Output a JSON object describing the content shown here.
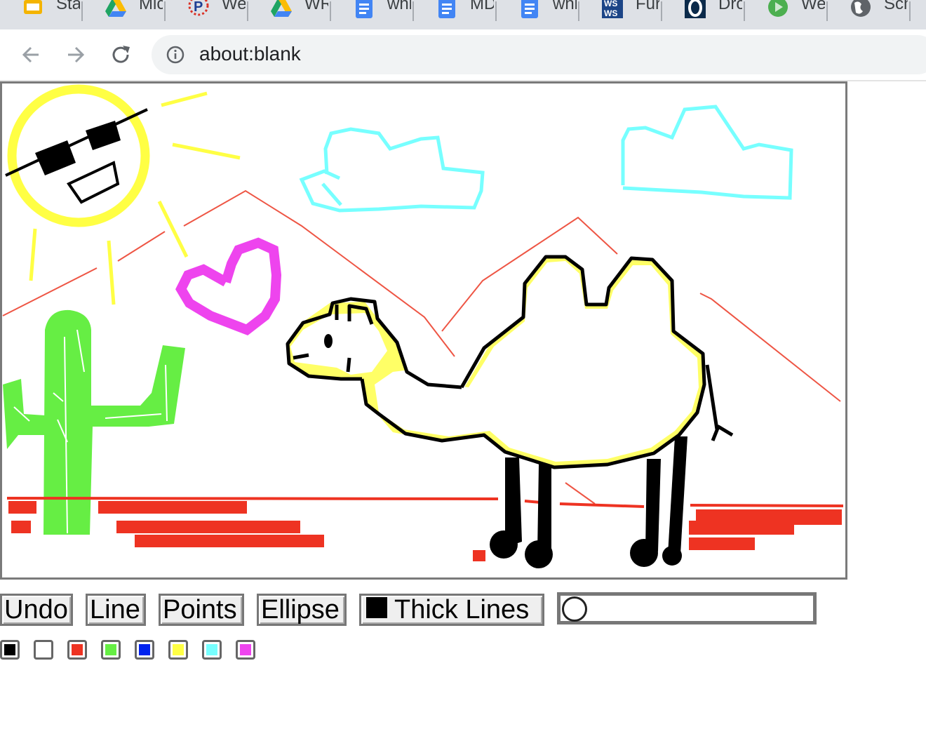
{
  "browser": {
    "tabs": [
      {
        "label": "Sta",
        "icon": "slides-icon",
        "color": "#f4b400"
      },
      {
        "label": "Mic",
        "icon": "drive-icon",
        "color": "#1fa463"
      },
      {
        "label": "Wel",
        "icon": "p-logo-icon",
        "color": "#d93025"
      },
      {
        "label": "WR",
        "icon": "drive-icon",
        "color": "#1fa463"
      },
      {
        "label": "whi",
        "icon": "docs-icon",
        "color": "#4285f4"
      },
      {
        "label": "MD",
        "icon": "docs-icon",
        "color": "#4285f4"
      },
      {
        "label": "whi",
        "icon": "docs-icon",
        "color": "#4285f4"
      },
      {
        "label": "Fur",
        "icon": "ws-logo-icon",
        "color": "#1c4587"
      },
      {
        "label": "Dro",
        "icon": "o-logo-icon",
        "color": "#0b2a4a"
      },
      {
        "label": "We",
        "icon": "video-icon",
        "color": "#4caf50"
      },
      {
        "label": "Sch",
        "icon": "globe-icon",
        "color": "#5f6368"
      }
    ],
    "url": "about:blank"
  },
  "controls": {
    "undo": "Undo",
    "line": "Line",
    "points": "Points",
    "ellipse": "Ellipse",
    "thick": "Thick Lines",
    "slider_value": 0
  },
  "palette": [
    "#000000",
    "#ffffff",
    "#ee3322",
    "#66ee44",
    "#0022ee",
    "#ffff44",
    "#77ffff",
    "#ee44ee"
  ]
}
